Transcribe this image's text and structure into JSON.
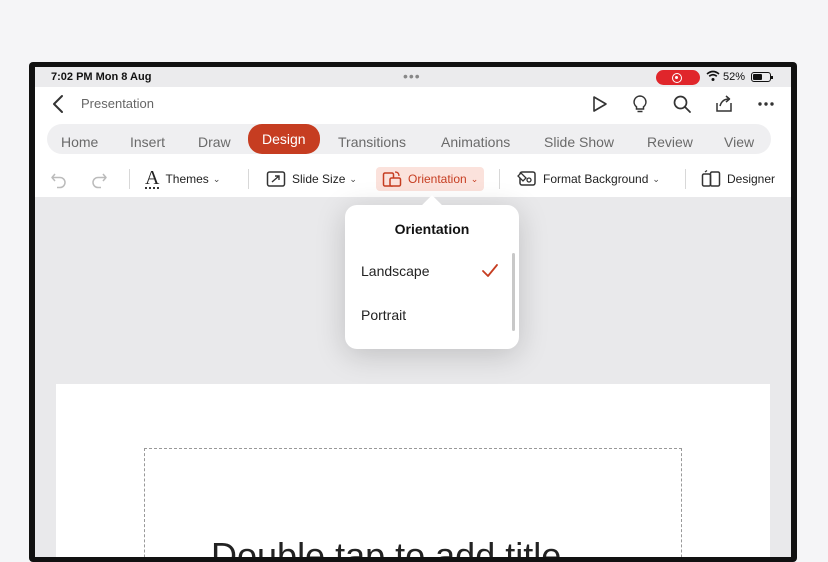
{
  "status": {
    "time": "7:02 PM  Mon 8 Aug",
    "battery": "52%"
  },
  "titlebar": {
    "title": "Presentation"
  },
  "tabs": [
    {
      "label": "Home"
    },
    {
      "label": "Insert"
    },
    {
      "label": "Draw"
    },
    {
      "label": "Design"
    },
    {
      "label": "Transitions"
    },
    {
      "label": "Animations"
    },
    {
      "label": "Slide Show"
    },
    {
      "label": "Review"
    },
    {
      "label": "View"
    }
  ],
  "ribbon": {
    "themes": "Themes",
    "slide_size": "Slide Size",
    "orientation": "Orientation",
    "format_background": "Format Background",
    "designer": "Designer"
  },
  "popover": {
    "title": "Orientation",
    "options": [
      "Landscape",
      "Portrait"
    ],
    "selected": "Landscape"
  },
  "slide": {
    "title_placeholder": "Double tap to add title"
  },
  "colors": {
    "accent": "#c63d21",
    "record": "#e0262b"
  }
}
